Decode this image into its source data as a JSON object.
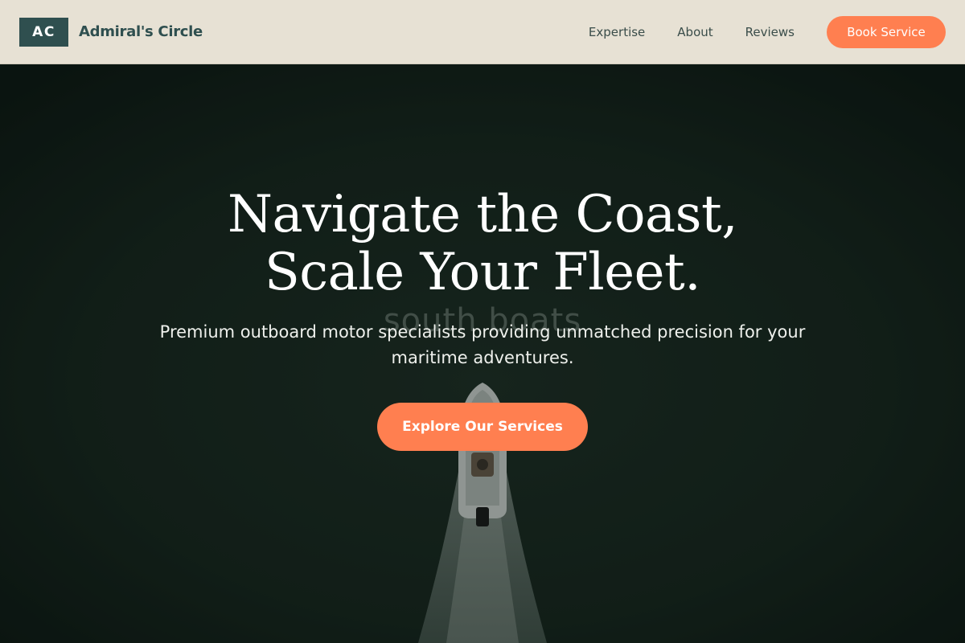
{
  "brand": {
    "logo_text": "AC",
    "name": "Admiral's Circle"
  },
  "nav": {
    "links": [
      "Expertise",
      "About",
      "Reviews"
    ],
    "cta_label": "Book Service"
  },
  "hero": {
    "headline_line1": "Navigate the Coast,",
    "headline_line2": "Scale Your Fleet.",
    "watermark": "south boats",
    "subhead": "Premium outboard motor specialists providing unmatched precision for your maritime adventures.",
    "cta_label": "Explore Our Services",
    "background_image": "aerial-boat-wake-photo"
  },
  "colors": {
    "header_bg": "#e7e1d4",
    "brand_dark": "#2f4f4f",
    "accent": "#ff7f50",
    "hero_bg": "#14231c"
  }
}
